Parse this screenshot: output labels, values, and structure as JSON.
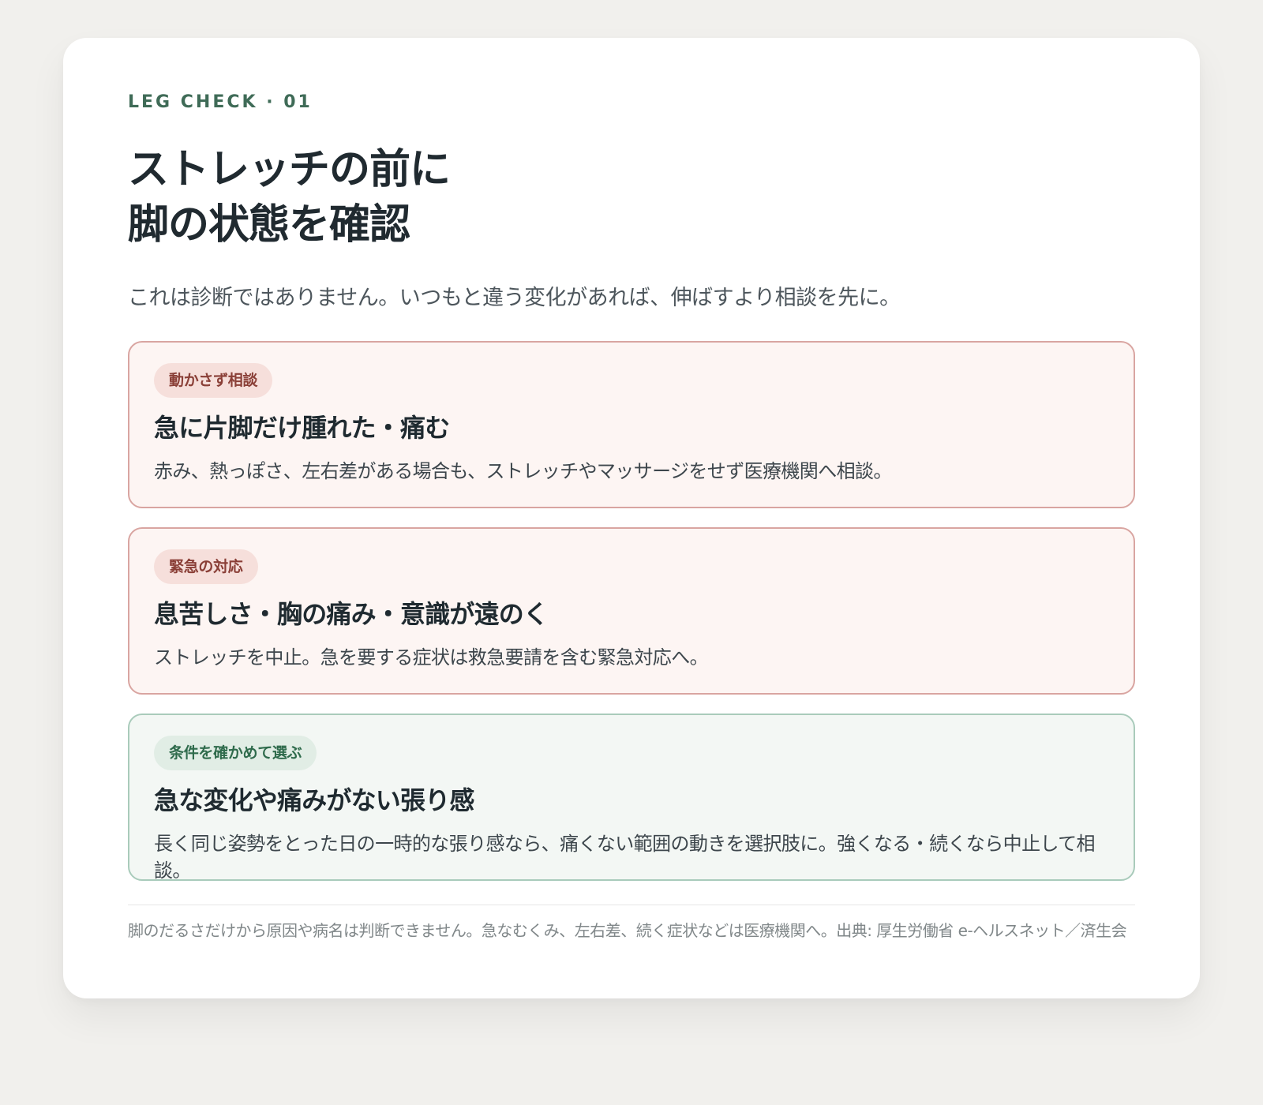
{
  "card": {
    "eyebrow": "LEG CHECK · 01",
    "title_lines": [
      "ストレッチの前に",
      "脚の状態を確認"
    ],
    "lead": "これは診断ではありません。いつもと違う変化があれば、伸ばすより相談を先に。",
    "items": [
      {
        "badge": "動かさず相談",
        "title": "急に片脚だけ腫れた・痛む",
        "desc": "赤み、熱っぽさ、左右差がある場合も、ストレッチやマッサージをせず医療機関へ相談。",
        "tone": "warning"
      },
      {
        "badge": "緊急の対応",
        "title": "息苦しさ・胸の痛み・意識が遠のく",
        "desc": "ストレッチを中止。急を要する症状は救急要請を含む緊急対応へ。",
        "tone": "warning"
      },
      {
        "badge": "条件を確かめて選ぶ",
        "title": "急な変化や痛みがない張り感",
        "desc": "長く同じ姿勢をとった日の一時的な張り感なら、痛くない範囲の動きを選択肢に。強くなる・続くなら中止して相談。",
        "tone": "ok"
      }
    ],
    "footnote": "脚のだるさだけから原因や病名は判断できません。急なむくみ、左右差、続く症状などは医療機関へ。出典: 厚生労働省 e-ヘルスネット／済生会"
  },
  "colors": {
    "page_background": "#f1f0ed",
    "accent_green": "#3f6b57",
    "warning_border": "#d9a5a1",
    "warning_background": "#fdf5f3",
    "warning_badge_text": "#8a3f37",
    "ok_border": "#a9cbbb",
    "ok_background": "#f3f7f4",
    "ok_badge_text": "#2f6b4c"
  }
}
